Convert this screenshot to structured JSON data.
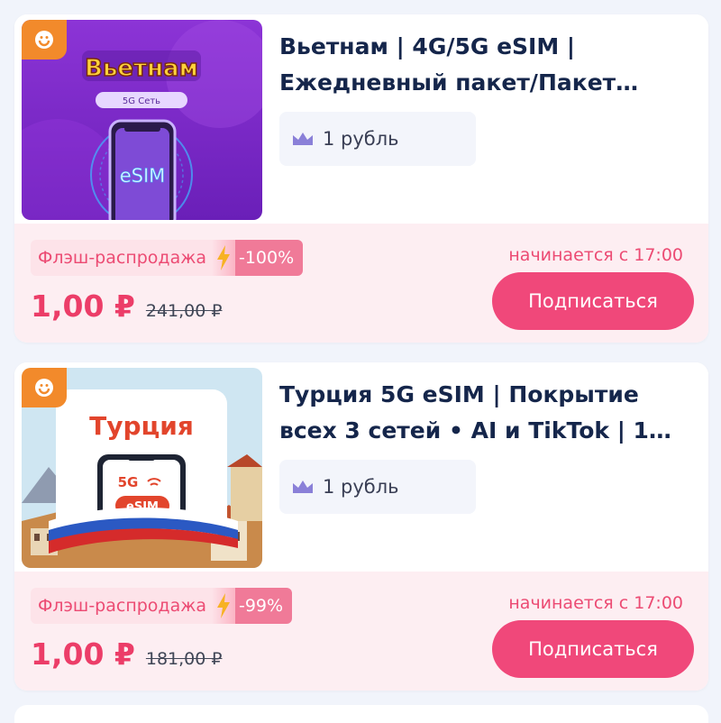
{
  "products": [
    {
      "title": "Вьетнам | 4G/5G eSIM | Ежедневный пакет/Пакет…",
      "thumb": {
        "country": "Вьетнам",
        "network": "5G Сеть",
        "esim": "eSIM"
      },
      "vip_price": "1 рубль",
      "flash_label": "Флэш-распродажа",
      "discount": "-100%",
      "starts_at": "начинается с 17:00",
      "price": "1,00 ₽",
      "old_price": "241,00 ₽",
      "subscribe_label": "Подписаться"
    },
    {
      "title": "Турция 5G eSIM | Покрытие всех 3 сетей • AI и TikTok | 1…",
      "thumb": {
        "country": "Турция",
        "network": "5G",
        "esim": "eSIM"
      },
      "vip_price": "1 рубль",
      "flash_label": "Флэш-распродажа",
      "discount": "-99%",
      "starts_at": "начинается с 17:00",
      "price": "1,00 ₽",
      "old_price": "181,00 ₽",
      "subscribe_label": "Подписаться"
    }
  ],
  "colors": {
    "accent": "#f0487a",
    "price": "#ec3d68",
    "title": "#15264b",
    "badge": "#f28a2b"
  }
}
